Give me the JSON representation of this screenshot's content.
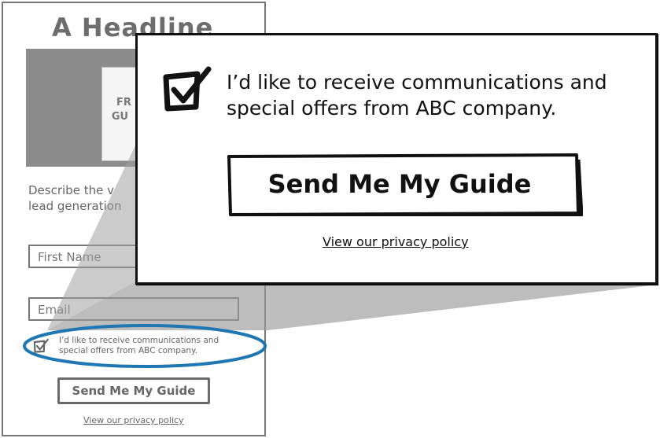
{
  "colors": {
    "wireframe_border": "#777777",
    "hero_fill": "#8c8c8c",
    "zoom_wedge": "#9a9a9a",
    "highlight_ellipse": "#1f77b4",
    "callout_text": "#111111"
  },
  "wireframe": {
    "headline": "A Headline",
    "guide_cover_text_line1": "FR",
    "guide_cover_text_line2": "GU",
    "description_line1": "Describe the v",
    "description_line2": "lead generation",
    "first_name_placeholder": "First Name",
    "email_placeholder": "Email",
    "consent_line1": "I’d like to receive communications and",
    "consent_line2": "special offers from ABC company.",
    "consent_checked": true,
    "submit_label": "Send Me My Guide",
    "privacy_link": "View our privacy policy"
  },
  "callout": {
    "consent_line1": "I’d like to receive communications and",
    "consent_line2": "special offers from ABC company.",
    "consent_checked": true,
    "submit_label": "Send Me My Guide",
    "privacy_link": "View our privacy policy"
  },
  "icons": {
    "checkbox": "checked-checkbox-icon"
  }
}
